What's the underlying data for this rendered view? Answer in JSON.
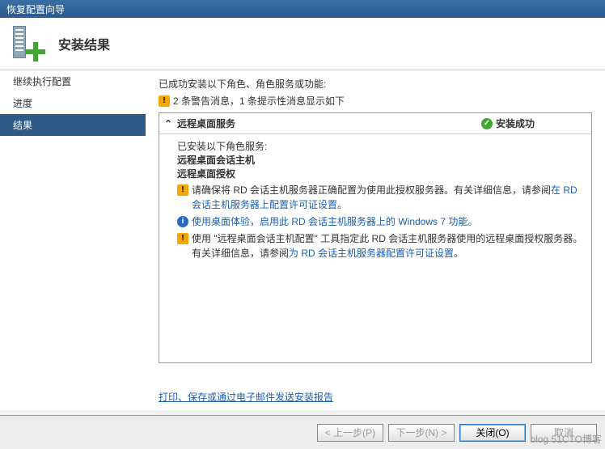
{
  "window": {
    "title": "恢复配置向导"
  },
  "header": {
    "title": "安装结果"
  },
  "sidebar": {
    "items": [
      {
        "label": "继续执行配置"
      },
      {
        "label": "进度"
      },
      {
        "label": "结果"
      }
    ]
  },
  "content": {
    "intro": "已成功安装以下角色、角色服务或功能:",
    "summary": "2 条警告消息，1 条提示性消息显示如下",
    "role_name": "远程桌面服务",
    "status": "安装成功",
    "services_intro": "已安装以下角色服务:",
    "service1": "远程桌面会话主机",
    "service2": "远程桌面授权",
    "msg1_a": "请确保将 RD 会话主机服务器正确配置为使用此授权服务器。有关详细信息，请参阅",
    "msg1_link": "在 RD 会话主机服务器上配置许可证设置",
    "msg1_b": "。",
    "msg2_a": "使用桌面体验，启用此 RD 会话主机服务器上的 Windows 7 功能。",
    "msg3_a": "使用 \"远程桌面会话主机配置\" 工具指定此 RD 会话主机服务器使用的远程桌面授权服务器。有关详细信息，请参阅",
    "msg3_link": "为 RD 会话主机服务器配置许可证设置",
    "msg3_b": "。",
    "report_link": "打印、保存或通过电子邮件发送安装报告"
  },
  "footer": {
    "back": "< 上一步(P)",
    "next": "下一步(N) >",
    "close": "关闭(O)",
    "cancel": "取消"
  },
  "watermark": "blog 51CTO博客"
}
